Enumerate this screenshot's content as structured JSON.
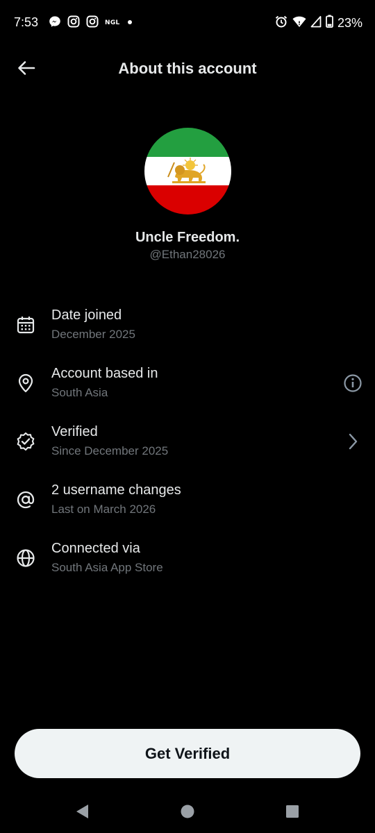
{
  "status_bar": {
    "time": "7:53",
    "notification_icons": [
      "messenger-icon",
      "instagram-icon",
      "instagram-icon",
      "ngl-icon",
      "dot-icon"
    ],
    "ngl_label": "NGL",
    "system_icons": [
      "alarm-icon",
      "wifi-icon",
      "cellular-icon",
      "battery-icon"
    ],
    "battery_percent": "23%"
  },
  "header": {
    "title": "About this account"
  },
  "profile": {
    "display_name": "Uncle Freedom.",
    "handle": "@Ethan28026"
  },
  "info_items": [
    {
      "icon": "calendar-icon",
      "title": "Date joined",
      "subtitle": "December 2025"
    },
    {
      "icon": "location-pin-icon",
      "title": "Account based in",
      "subtitle": "South Asia",
      "trailing": "info-icon"
    },
    {
      "icon": "verified-badge-icon",
      "title": "Verified",
      "subtitle": "Since December 2025",
      "trailing": "chevron-right-icon"
    },
    {
      "icon": "at-sign-icon",
      "title": "2 username changes",
      "subtitle": "Last on March 2026"
    },
    {
      "icon": "globe-icon",
      "title": "Connected via",
      "subtitle": "South Asia App Store"
    }
  ],
  "cta": {
    "label": "Get Verified"
  },
  "nav_bar": {
    "buttons": [
      "back-triangle-icon",
      "home-circle-icon",
      "recents-square-icon"
    ]
  },
  "colors": {
    "background": "#000000",
    "primary_text": "#e7e9ea",
    "secondary_text": "#71767b",
    "button_bg": "#eff3f4",
    "button_text": "#0f1419",
    "flag_green": "#239f40",
    "flag_white": "#ffffff",
    "flag_red": "#da0000",
    "lion_gold": "#e0a526"
  }
}
